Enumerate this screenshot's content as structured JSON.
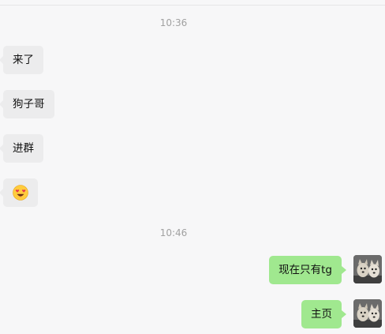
{
  "chat": {
    "timestamps": [
      "10:36",
      "10:46"
    ],
    "incoming_messages": [
      {
        "text": "来了"
      },
      {
        "text": "狗子哥"
      },
      {
        "text": "进群"
      },
      {
        "emoji": "heart-eyes-emoji"
      }
    ],
    "outgoing_messages": [
      {
        "text": "现在只有tg"
      },
      {
        "text": "主页"
      }
    ],
    "colors": {
      "background": "#f7f7f8",
      "incoming_bubble": "#ececed",
      "outgoing_bubble": "#a0e88f",
      "timestamp_text": "#a1a1a1"
    }
  }
}
